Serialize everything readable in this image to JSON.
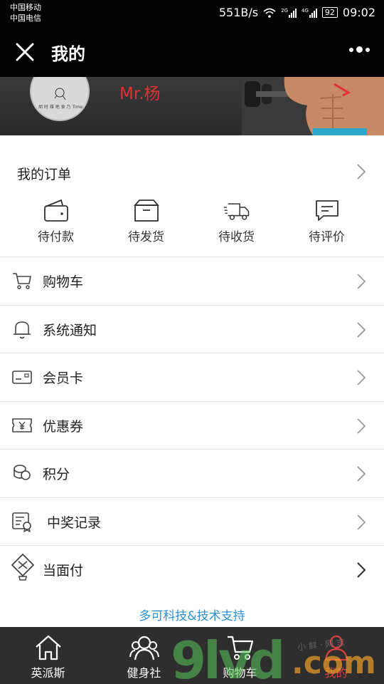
{
  "statusbar": {
    "carrier1": "中国移动",
    "carrier2": "中国电信",
    "speed": "551B/s",
    "net1": "2G",
    "net2": "4G",
    "battery": "92",
    "time": "09:02"
  },
  "header": {
    "title": "我的"
  },
  "profile": {
    "username": "Mr.杨",
    "avatar_text": "胡 时 雄 地 食 乃 Time"
  },
  "orders": {
    "title": "我的订单",
    "items": [
      {
        "label": "待付款",
        "icon": "wallet-icon"
      },
      {
        "label": "待发货",
        "icon": "box-icon"
      },
      {
        "label": "待收货",
        "icon": "truck-icon"
      },
      {
        "label": "待评价",
        "icon": "comment-icon"
      }
    ]
  },
  "menu": [
    {
      "label": "购物车",
      "icon": "cart-icon"
    },
    {
      "label": "系统通知",
      "icon": "bell-icon"
    },
    {
      "label": "会员卡",
      "icon": "card-icon"
    },
    {
      "label": "优惠券",
      "icon": "coupon-icon"
    },
    {
      "label": "积分",
      "icon": "coins-icon"
    },
    {
      "label": "中奖记录",
      "icon": "certificate-icon"
    },
    {
      "label": "当面付",
      "icon": "pay-icon"
    }
  ],
  "footer": {
    "credit": "多可科技&技术支持"
  },
  "bottom_nav": [
    {
      "label": "英派斯",
      "icon": "home-icon"
    },
    {
      "label": "健身社",
      "icon": "community-icon"
    },
    {
      "label": "购物车",
      "icon": "cart-icon"
    },
    {
      "label": "我的",
      "icon": "user-icon"
    }
  ],
  "watermark": {
    "main": "9lvd",
    "suffix": ".com",
    "sub": "小 鲜 · 网 志"
  },
  "colors": {
    "accent_red": "#e03232",
    "link_blue": "#2b8fd6",
    "nav_bg": "#2e2e2e"
  }
}
